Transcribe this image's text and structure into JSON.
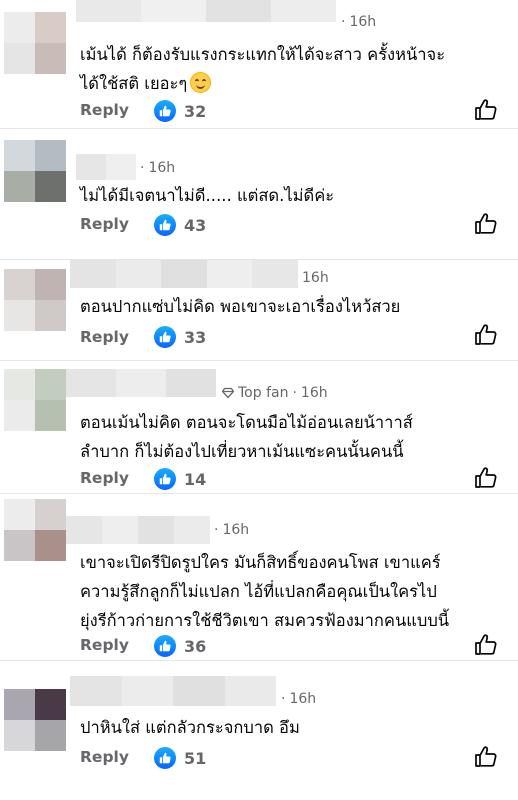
{
  "comments": [
    {
      "name_hidden": true,
      "badge": "",
      "time": "16h",
      "text": "เม้นได้ ก็ต้องรับแรงกระแทกให้ได้จะสาว ครั้งหน้าจะ\nได้ใช้สติ เยอะๆ",
      "emoji": "smiling-face",
      "reply_label": "Reply",
      "like_count": "32"
    },
    {
      "name_hidden": true,
      "badge": "",
      "time": "16h",
      "text": "ไม่ได้มีเจตนาไม่ดี..... แต่สด.ไม่ดีค่ะ",
      "emoji": "",
      "reply_label": "Reply",
      "like_count": "43"
    },
    {
      "name_hidden": true,
      "badge": "",
      "time": "16h",
      "text": "ตอนปากแซ่บไม่คิด พอเขาจะเอาเรื่องไหว้สวย",
      "emoji": "",
      "reply_label": "Reply",
      "like_count": "33"
    },
    {
      "name_hidden": true,
      "badge": "Top fan",
      "badge_icon": "diamond-icon",
      "time": "16h",
      "text": "ตอนเม้นไม่คิด  ตอนจะโดนมือไม้อ่อนเลยน้าาาส์\nลำบาก ก็ไม่ต้องไปเที่ยวหาเม้นแซะคนนั้นคนนี้",
      "emoji": "",
      "reply_label": "Reply",
      "like_count": "14"
    },
    {
      "name_hidden": true,
      "badge": "",
      "time": "16h",
      "text": "เขาจะเปิดรีปิดรูปใคร มันก็สิทธิ์ของคนโพส เขาแคร์\nความรู้สึกลูกก็ไม่แปลก ไอ้ที่แปลกคือคุณเป็นใครไป\nยุ่งรีก้าวก่ายการใช้ชีวิตเขา สมควรฟ้องมากคนแบบนี้",
      "emoji": "",
      "reply_label": "Reply",
      "like_count": "36"
    },
    {
      "name_hidden": true,
      "badge": "",
      "time": "16h",
      "text": "ปาหินใส่ แต่กลัวกระจกบาด อึม",
      "emoji": "",
      "reply_label": "Reply",
      "like_count": "51"
    }
  ],
  "colors": {
    "like_blue": "#0866ff",
    "meta_grey": "#65676b",
    "text": "#050505"
  },
  "icons": {
    "like_badge": "thumbs-up-icon",
    "like_button": "thumbs-up-outline-icon",
    "emoji": "smiling-face-emoji"
  }
}
